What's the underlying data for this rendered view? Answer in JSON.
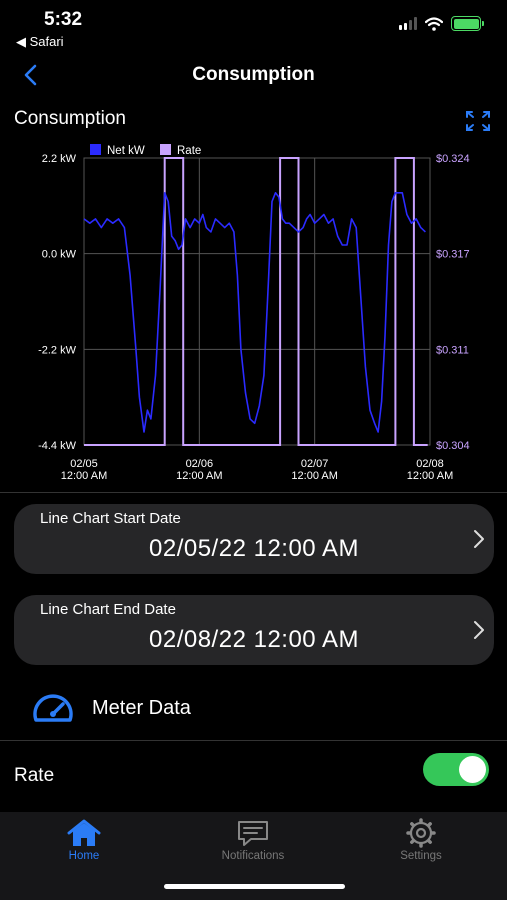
{
  "status_bar": {
    "time": "5:32",
    "back_app": "◀ Safari"
  },
  "nav": {
    "title": "Consumption",
    "back_icon": "chevron-left-icon"
  },
  "section": {
    "title": "Consumption",
    "expand_icon": "expand-icon"
  },
  "chart_data": {
    "type": "line",
    "legend": {
      "position": "top-left",
      "items": [
        "Net kW",
        "Rate"
      ]
    },
    "series": [
      {
        "name": "Net kW",
        "color": "#2b2bff",
        "axis": "left",
        "x": [
          0.0,
          0.05,
          0.1,
          0.15,
          0.2,
          0.25,
          0.3,
          0.35,
          0.4,
          0.45,
          0.48,
          0.52,
          0.55,
          0.58,
          0.62,
          0.66,
          0.7,
          0.73,
          0.76,
          0.79,
          0.82,
          0.85,
          0.88,
          0.92,
          0.96,
          1.0,
          1.03,
          1.06,
          1.1,
          1.14,
          1.18,
          1.22,
          1.26,
          1.3,
          1.33,
          1.36,
          1.4,
          1.44,
          1.48,
          1.52,
          1.56,
          1.6,
          1.63,
          1.66,
          1.69,
          1.72,
          1.75,
          1.78,
          1.82,
          1.86,
          1.9,
          1.93,
          1.96,
          2.0,
          2.04,
          2.08,
          2.12,
          2.16,
          2.2,
          2.24,
          2.28,
          2.32,
          2.36,
          2.4,
          2.44,
          2.48,
          2.52,
          2.55,
          2.58,
          2.61,
          2.64,
          2.67,
          2.7,
          2.73,
          2.76,
          2.8,
          2.84,
          2.88,
          2.92,
          2.96,
          3.0,
          3.04,
          3.08,
          3.12,
          3.16
        ],
        "values": [
          0.8,
          0.7,
          0.8,
          0.6,
          0.8,
          0.7,
          0.8,
          0.6,
          -0.5,
          -2.2,
          -3.3,
          -4.1,
          -3.6,
          -3.8,
          -2.8,
          -0.8,
          1.4,
          1.2,
          0.4,
          0.3,
          0.1,
          0.2,
          0.8,
          0.6,
          0.8,
          0.7,
          0.9,
          0.6,
          0.5,
          0.8,
          0.7,
          0.6,
          0.7,
          0.5,
          -0.5,
          -2.2,
          -3.2,
          -3.8,
          -3.9,
          -3.5,
          -2.8,
          -0.6,
          1.2,
          1.4,
          1.3,
          0.8,
          0.7,
          0.7,
          0.6,
          0.5,
          0.6,
          0.8,
          0.9,
          0.7,
          0.8,
          0.9,
          0.7,
          0.8,
          0.4,
          0.2,
          0.2,
          0.8,
          0.6,
          -1.0,
          -2.6,
          -3.6,
          -3.9,
          -4.1,
          -3.4,
          -1.9,
          0.2,
          1.2,
          1.4,
          1.4,
          1.4,
          0.9,
          0.7,
          0.8,
          0.6,
          0.5,
          0.8,
          0.9,
          0.7,
          0.8,
          0.8
        ],
        "hold": [
          0.0
        ]
      },
      {
        "name": "Rate",
        "color": "#c9a3ff",
        "axis": "right",
        "steps": [
          [
            0.0,
            0.304
          ],
          [
            0.7,
            0.304
          ],
          [
            0.7,
            0.324
          ],
          [
            0.86,
            0.324
          ],
          [
            0.86,
            0.304
          ],
          [
            1.7,
            0.304
          ],
          [
            1.7,
            0.324
          ],
          [
            1.86,
            0.324
          ],
          [
            1.86,
            0.304
          ],
          [
            2.7,
            0.304
          ],
          [
            2.7,
            0.324
          ],
          [
            2.86,
            0.324
          ],
          [
            2.86,
            0.304
          ],
          [
            3.08,
            0.304
          ]
        ]
      }
    ],
    "x_ticks": [
      {
        "x": 0,
        "line1": "02/05",
        "line2": "12:00 AM"
      },
      {
        "x": 1,
        "line1": "02/06",
        "line2": "12:00 AM"
      },
      {
        "x": 2,
        "line1": "02/07",
        "line2": "12:00 AM"
      },
      {
        "x": 3,
        "line1": "02/08",
        "line2": "12:00 AM"
      }
    ],
    "xlim": [
      0,
      3.0
    ],
    "y_left_ticks": [
      "2.2 kW",
      "0.0 kW",
      "-2.2 kW",
      "-4.4 kW"
    ],
    "y_left_lim": [
      -4.4,
      2.2
    ],
    "y_right_ticks": [
      "$0.324",
      "$0.317",
      "$0.311",
      "$0.304"
    ],
    "y_right_lim": [
      0.304,
      0.324
    ],
    "grid": true,
    "colors": {
      "net": "#2b2bff",
      "rate": "#c9a3ff",
      "grid": "#555555"
    }
  },
  "start_card": {
    "label": "Line Chart Start Date",
    "value": "02/05/22 12:00 AM"
  },
  "end_card": {
    "label": "Line Chart End Date",
    "value": "02/08/22 12:00 AM"
  },
  "meter": {
    "label": "Meter Data",
    "icon": "speedometer-icon"
  },
  "rate": {
    "label": "Rate",
    "toggle_on": true
  },
  "tabs": [
    {
      "label": "Home",
      "icon": "home-icon",
      "active": true
    },
    {
      "label": "Notifications",
      "icon": "message-icon",
      "active": false
    },
    {
      "label": "Settings",
      "icon": "gear-icon",
      "active": false
    }
  ],
  "accent": "#2b7cf6"
}
